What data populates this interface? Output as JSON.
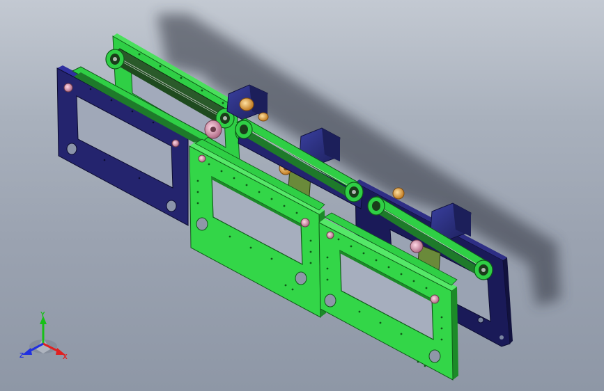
{
  "viewport": {
    "background_top": "#c3c9d2",
    "background_bottom": "#8e97a6"
  },
  "colors": {
    "green_plate": "#33d648",
    "green_plate_dark": "#1f9a2e",
    "green_plate_edge": "#0f5a18",
    "navy_plate": "#23236e",
    "navy_plate_dark": "#13134a",
    "motor_navy": "#2a2f78",
    "belt_dark": "#1a3d1a",
    "bearing_orange": "#e8a23a",
    "bearing_pink": "#e0a0b8",
    "shaft_gray": "#9aa0a8",
    "shadow": "#3a3f48"
  },
  "triad": {
    "x_label": "X",
    "y_label": "Y",
    "z_label": "Z",
    "x_color": "#e02020",
    "y_color": "#18c018",
    "z_color": "#2030e0"
  }
}
